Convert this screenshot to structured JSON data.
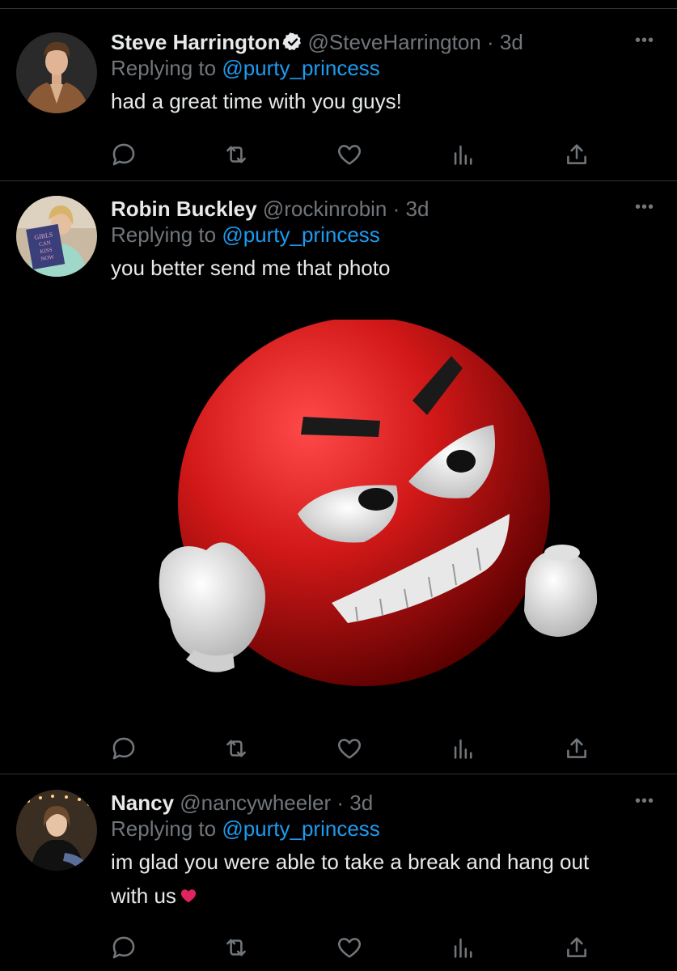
{
  "tweets": [
    {
      "name": "Steve Harrington",
      "verified": true,
      "handle": "@SteveHarrington",
      "dot": "·",
      "time": "3d",
      "reply_prefix": "Replying to ",
      "reply_mention": "@purty_princess",
      "text": "had a great time with you guys!",
      "more": "•••"
    },
    {
      "name": "Robin Buckley",
      "verified": false,
      "handle": "@rockinrobin",
      "dot": "·",
      "time": "3d",
      "reply_prefix": "Replying to ",
      "reply_mention": "@purty_princess",
      "text": "you better send me that photo",
      "more": "•••",
      "avatar_book_text": [
        "GIRLS",
        "CAN",
        "KISS",
        "NOW"
      ],
      "media_description_icon": "angry-red-emoji-image"
    },
    {
      "name": "Nancy",
      "verified": false,
      "handle": "@nancywheeler",
      "dot": "·",
      "time": "3d",
      "reply_prefix": "Replying to ",
      "reply_mention": "@purty_princess",
      "text_line1": "im glad you were able to take a break and hang out",
      "text_line2": "with us",
      "emoji_icon": "red-heart-emoji",
      "more": "•••"
    }
  ],
  "action_icons": [
    "reply-icon",
    "retweet-icon",
    "like-icon",
    "analytics-icon",
    "share-icon"
  ],
  "colors": {
    "background": "#000000",
    "text": "#e7e9ea",
    "muted": "#71767b",
    "link": "#1d9bf0",
    "divider": "#2f3336"
  }
}
